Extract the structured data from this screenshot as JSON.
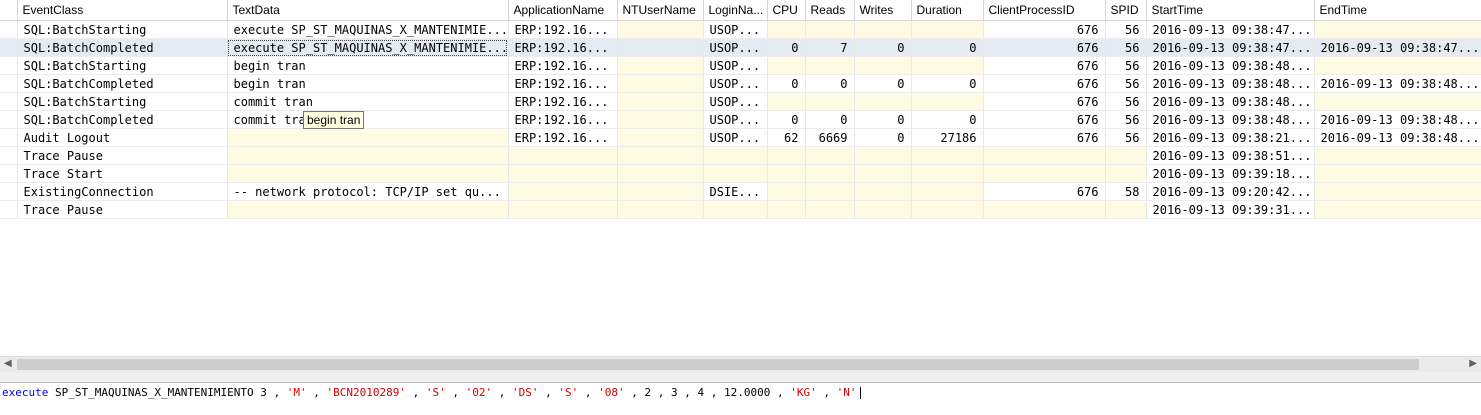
{
  "columns": [
    "EventClass",
    "TextData",
    "ApplicationName",
    "NTUserName",
    "LoginNa...",
    "CPU",
    "Reads",
    "Writes",
    "Duration",
    "ClientProcessID",
    "SPID",
    "StartTime",
    "EndTime"
  ],
  "rows": [
    {
      "event": "SQL:BatchStarting",
      "text": "execute SP_ST_MAQUINAS_X_MANTENIMIE...",
      "app": "ERP:192.16...",
      "ntuser": "",
      "login": "USOP...",
      "cpu": "",
      "reads": "",
      "writes": "",
      "duration": "",
      "cpid": "676",
      "spid": "56",
      "start": "2016-09-13 09:38:47...",
      "end": ""
    },
    {
      "event": "SQL:BatchCompleted",
      "text": "execute SP_ST_MAQUINAS_X_MANTENIMIE...",
      "app": "ERP:192.16...",
      "ntuser": "",
      "login": "USOP...",
      "cpu": "0",
      "reads": "7",
      "writes": "0",
      "duration": "0",
      "cpid": "676",
      "spid": "56",
      "start": "2016-09-13 09:38:47...",
      "end": "2016-09-13 09:38:47...",
      "selected": true
    },
    {
      "event": "SQL:BatchStarting",
      "text": "begin tran",
      "app": "ERP:192.16...",
      "ntuser": "",
      "login": "USOP...",
      "cpu": "",
      "reads": "",
      "writes": "",
      "duration": "",
      "cpid": "676",
      "spid": "56",
      "start": "2016-09-13 09:38:48...",
      "end": ""
    },
    {
      "event": "SQL:BatchCompleted",
      "text": "begin tran",
      "app": "ERP:192.16...",
      "ntuser": "",
      "login": "USOP...",
      "cpu": "0",
      "reads": "0",
      "writes": "0",
      "duration": "0",
      "cpid": "676",
      "spid": "56",
      "start": "2016-09-13 09:38:48...",
      "end": "2016-09-13 09:38:48..."
    },
    {
      "event": "SQL:BatchStarting",
      "text": "commit tran",
      "app": "ERP:192.16...",
      "ntuser": "",
      "login": "USOP...",
      "cpu": "",
      "reads": "",
      "writes": "",
      "duration": "",
      "cpid": "676",
      "spid": "56",
      "start": "2016-09-13 09:38:48...",
      "end": ""
    },
    {
      "event": "SQL:BatchCompleted",
      "text": "commit tran",
      "app": "ERP:192.16...",
      "ntuser": "",
      "login": "USOP...",
      "cpu": "0",
      "reads": "0",
      "writes": "0",
      "duration": "0",
      "cpid": "676",
      "spid": "56",
      "start": "2016-09-13 09:38:48...",
      "end": "2016-09-13 09:38:48..."
    },
    {
      "event": "Audit Logout",
      "text": "",
      "app": "ERP:192.16...",
      "ntuser": "",
      "login": "USOP...",
      "cpu": "62",
      "reads": "6669",
      "writes": "0",
      "duration": "27186",
      "cpid": "676",
      "spid": "56",
      "start": "2016-09-13 09:38:21...",
      "end": "2016-09-13 09:38:48..."
    },
    {
      "event": "Trace Pause",
      "text": "",
      "app": "",
      "ntuser": "",
      "login": "",
      "cpu": "",
      "reads": "",
      "writes": "",
      "duration": "",
      "cpid": "",
      "spid": "",
      "start": "2016-09-13 09:38:51...",
      "end": ""
    },
    {
      "event": "Trace Start",
      "text": "",
      "app": "",
      "ntuser": "",
      "login": "",
      "cpu": "",
      "reads": "",
      "writes": "",
      "duration": "",
      "cpid": "",
      "spid": "",
      "start": "2016-09-13 09:39:18...",
      "end": ""
    },
    {
      "event": "ExistingConnection",
      "text": "-- network protocol: TCP/IP  set qu...",
      "app": "",
      "ntuser": "",
      "login": "DSIE...",
      "cpu": "",
      "reads": "",
      "writes": "",
      "duration": "",
      "cpid": "676",
      "spid": "58",
      "start": "2016-09-13 09:20:42...",
      "end": "",
      "green": true
    },
    {
      "event": "Trace Pause",
      "text": "",
      "app": "",
      "ntuser": "",
      "login": "",
      "cpu": "",
      "reads": "",
      "writes": "",
      "duration": "",
      "cpid": "",
      "spid": "",
      "start": "2016-09-13 09:39:31...",
      "end": ""
    }
  ],
  "tooltip": "begin tran",
  "detail": {
    "tokens": [
      {
        "t": "execute",
        "c": "kw"
      },
      {
        "t": " SP_ST_MAQUINAS_X_MANTENIMIENTO 3 , ",
        "c": "plain"
      },
      {
        "t": "'M'",
        "c": "str"
      },
      {
        "t": " , ",
        "c": "plain"
      },
      {
        "t": "'BCN2010289'",
        "c": "str"
      },
      {
        "t": " , ",
        "c": "plain"
      },
      {
        "t": "'S'",
        "c": "str"
      },
      {
        "t": " , ",
        "c": "plain"
      },
      {
        "t": "'02'",
        "c": "str"
      },
      {
        "t": " , ",
        "c": "plain"
      },
      {
        "t": "'DS'",
        "c": "str"
      },
      {
        "t": " , ",
        "c": "plain"
      },
      {
        "t": "'S'",
        "c": "str"
      },
      {
        "t": " , ",
        "c": "plain"
      },
      {
        "t": "'08'",
        "c": "str"
      },
      {
        "t": " , 2 , 3 , 4 , 12.0000 , ",
        "c": "plain"
      },
      {
        "t": "'KG'",
        "c": "str"
      },
      {
        "t": " , ",
        "c": "plain"
      },
      {
        "t": "'N'",
        "c": "str"
      }
    ]
  },
  "colors": {
    "empty_cell": "#fffbe2",
    "selected_row": "#e6ebf3",
    "green_text": "#078a07",
    "keyword": "#0000ee",
    "string": "#d40000"
  }
}
